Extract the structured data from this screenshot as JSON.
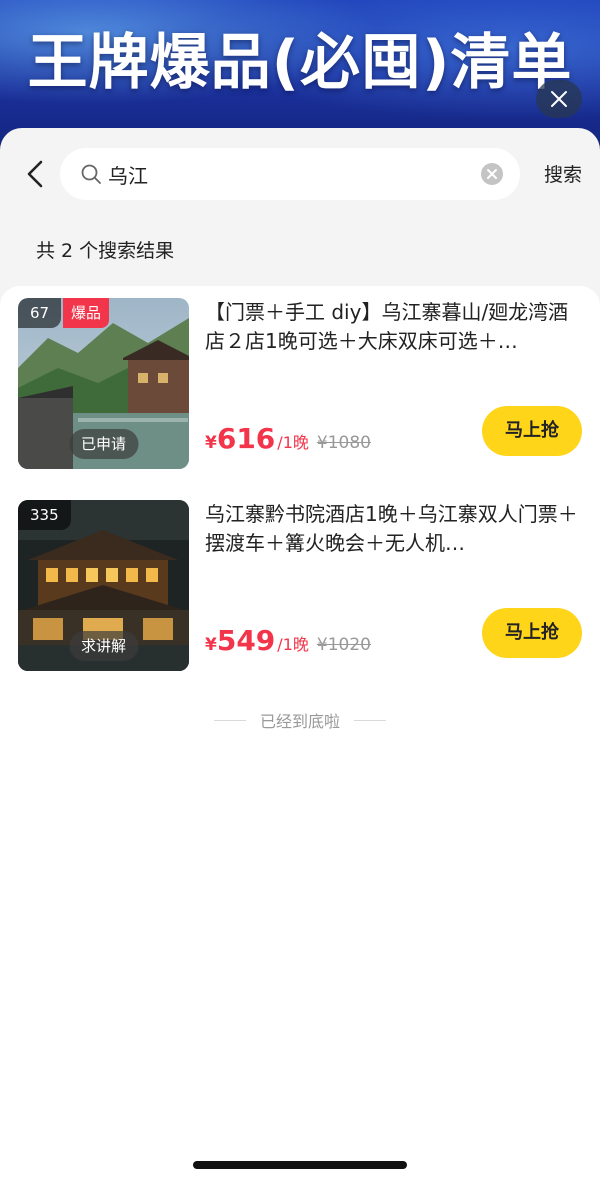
{
  "banner": {
    "title": "王牌爆品(必囤)清单",
    "close_icon": "close-icon"
  },
  "search": {
    "back_icon": "chevron-left-icon",
    "query": "乌江",
    "search_icon": "search-icon",
    "clear_icon": "clear-circle-icon",
    "button_label": "搜索"
  },
  "results": {
    "summary": "共 2 个搜索结果",
    "items": [
      {
        "views": "67",
        "badge": "爆品",
        "status": "已申请",
        "title": "【门票＋手工 diy】乌江寨暮山/廻龙湾酒店２店1晚可选＋大床双床可选＋…",
        "currency": "¥",
        "price": "616",
        "unit": "/1晚",
        "original_price": "¥1080",
        "buy_label": "马上抢"
      },
      {
        "views": "335",
        "badge": "",
        "status": "求讲解",
        "title": "乌江寨黔书院酒店1晚＋乌江寨双人门票＋摆渡车＋篝火晚会＋无人机…",
        "currency": "¥",
        "price": "549",
        "unit": "/1晚",
        "original_price": "¥1020",
        "buy_label": "马上抢"
      }
    ],
    "end_text": "已经到底啦"
  },
  "colors": {
    "accent_red": "#f2354b",
    "button_yellow": "#ffd51a",
    "banner_blue": "#1d3fb8"
  }
}
